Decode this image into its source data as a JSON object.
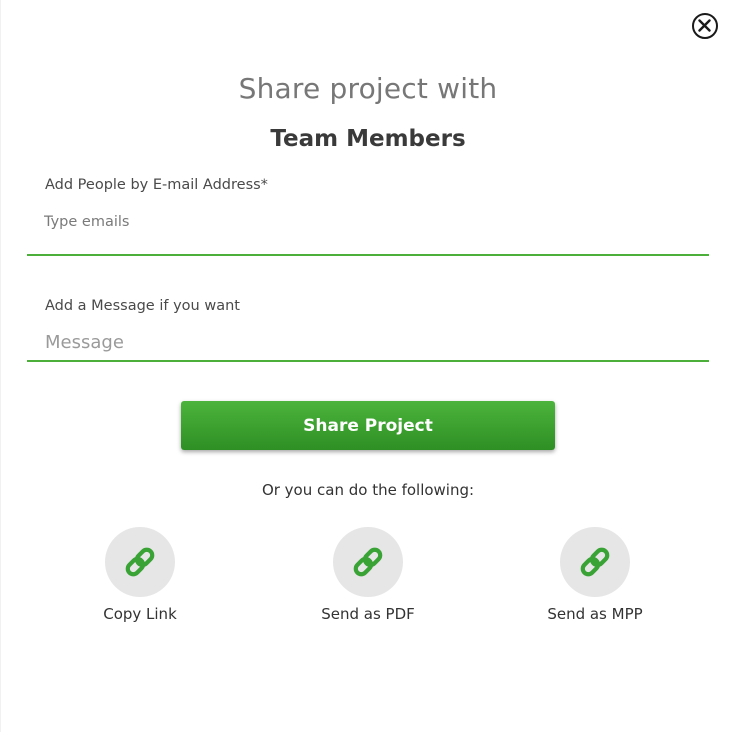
{
  "dialog": {
    "title": "Share project with",
    "subtitle": "Team Members",
    "close_icon": "close-circle-icon"
  },
  "emails": {
    "label": "Add People by E-mail Address*",
    "placeholder": "Type emails",
    "value": ""
  },
  "message": {
    "label": "Add a Message if you want",
    "placeholder": "Message",
    "value": ""
  },
  "share_button": {
    "label": "Share Project"
  },
  "alternatives": {
    "intro": "Or you can do the following:",
    "items": [
      {
        "label": "Copy Link",
        "icon": "link-icon"
      },
      {
        "label": "Send as PDF",
        "icon": "link-icon"
      },
      {
        "label": "Send as MPP",
        "icon": "link-icon"
      }
    ]
  },
  "colors": {
    "accent": "#4caf3a",
    "button_top": "#4cb43c",
    "button_bottom": "#2e8f24",
    "icon_circle": "#e6e6e6"
  }
}
